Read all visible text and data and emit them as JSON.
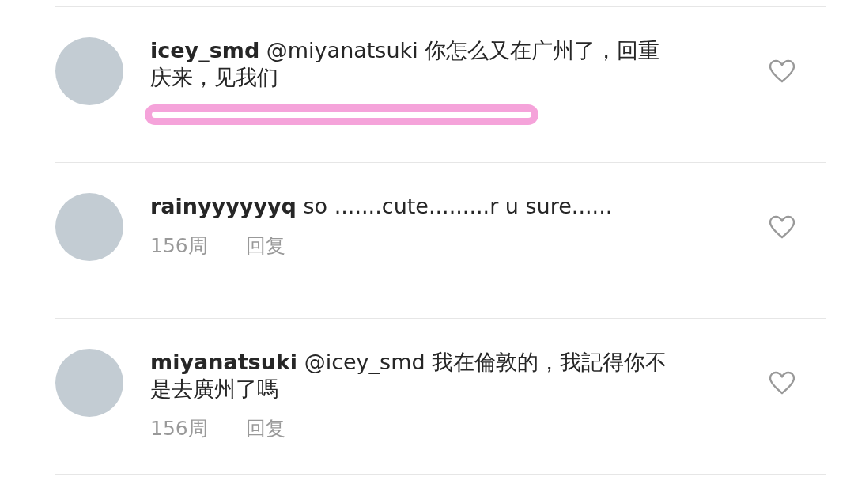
{
  "comments": [
    {
      "username": "icey_smd",
      "text": "@miyanatsuki 你怎么又在广州了，回重庆来，见我们",
      "scribbled": true,
      "liked": false
    },
    {
      "username": "rainyyyyyyq",
      "text": "so .......cute.........r u sure......",
      "time": "156周",
      "reply": "回复",
      "scribbled": false,
      "liked": false
    },
    {
      "username": "miyanatsuki",
      "text": "@icey_smd 我在倫敦的，我記得你不是去廣州了嗎",
      "time": "156周",
      "reply": "回复",
      "scribbled": false,
      "liked": false
    }
  ]
}
